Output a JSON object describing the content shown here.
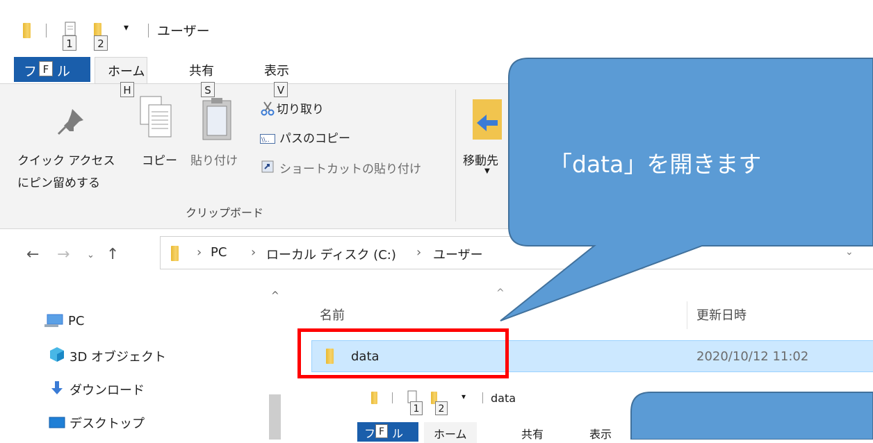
{
  "window": {
    "title": "ユーザー",
    "quick_access_keytips": [
      "1",
      "2"
    ]
  },
  "tabs": [
    {
      "label": "ファイル",
      "keytip": "F"
    },
    {
      "label": "ホーム",
      "keytip": "H"
    },
    {
      "label": "共有",
      "keytip": "S"
    },
    {
      "label": "表示",
      "keytip": "V"
    }
  ],
  "ribbon": {
    "pin_label_line1": "クイック アクセス",
    "pin_label_line2": "にピン留めする",
    "copy_label": "コピー",
    "paste_label": "貼り付け",
    "cut_label": "切り取り",
    "copy_path_label": "パスのコピー",
    "paste_shortcut_label": "ショートカットの貼り付け",
    "move_to_label": "移動先",
    "group_clipboard": "クリップボード"
  },
  "address": {
    "crumbs": [
      "PC",
      "ローカル ディスク (C:)",
      "ユーザー"
    ]
  },
  "nav_pane": {
    "items": [
      {
        "label": "PC",
        "icon": "pc-icon"
      },
      {
        "label": "3D オブジェクト",
        "icon": "3d-objects-icon"
      },
      {
        "label": "ダウンロード",
        "icon": "download-icon"
      },
      {
        "label": "デスクトップ",
        "icon": "desktop-icon"
      }
    ]
  },
  "file_list": {
    "col_name": "名前",
    "col_modified": "更新日時",
    "rows": [
      {
        "name": "data",
        "modified": "2020/10/12 11:02",
        "selected": true
      }
    ]
  },
  "callout": {
    "text": "「data」を開きます",
    "color": "#5b9bd5",
    "highlight_color": "#ff0000"
  },
  "nested_window": {
    "title": "data",
    "quick_access_keytips": [
      "1",
      "2"
    ],
    "tabs": [
      {
        "label": "ファイル",
        "keytip": "F"
      },
      {
        "label": "ホーム"
      },
      {
        "label": "共有"
      },
      {
        "label": "表示"
      }
    ]
  }
}
